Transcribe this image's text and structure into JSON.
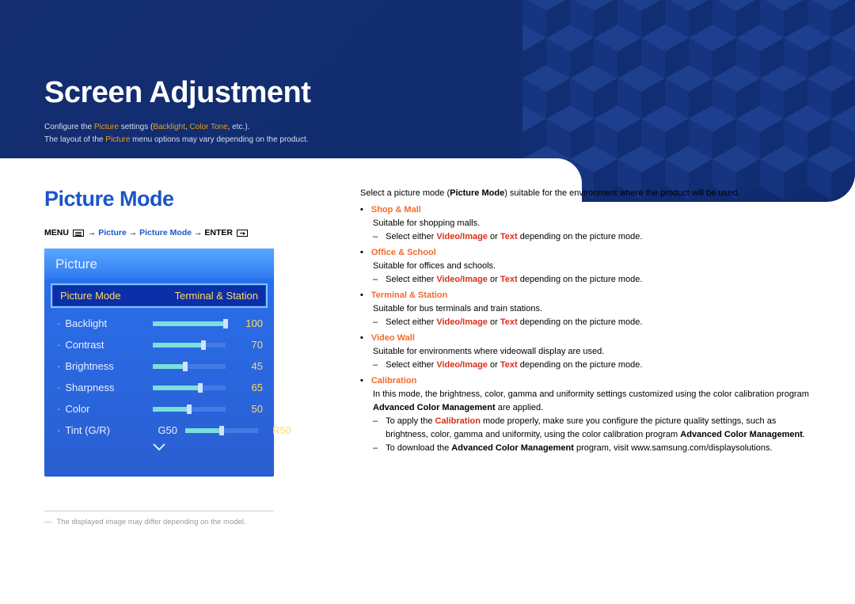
{
  "header": {
    "title": "Screen Adjustment",
    "intro_pre": "Configure the ",
    "intro_hl1": "Picture",
    "intro_mid": " settings (",
    "intro_hl2": "Backlight",
    "intro_sep": ", ",
    "intro_hl3": "Color Tone",
    "intro_post": ", etc.).",
    "intro2_pre": "The layout of the ",
    "intro2_hl": "Picture",
    "intro2_post": " menu options may vary depending on the product."
  },
  "section": {
    "title": "Picture Mode",
    "breadcrumb": {
      "menu": "MENU",
      "arrow": " → ",
      "b1": "Picture",
      "b2": "Picture Mode",
      "enter": "ENTER"
    }
  },
  "osd": {
    "panel_title": "Picture",
    "selected_label": "Picture Mode",
    "selected_value": "Terminal & Station",
    "rows": [
      {
        "label": "Backlight",
        "value": 100
      },
      {
        "label": "Contrast",
        "value": 70
      },
      {
        "label": "Brightness",
        "value": 45
      },
      {
        "label": "Sharpness",
        "value": 65
      },
      {
        "label": "Color",
        "value": 50
      }
    ],
    "tint": {
      "label": "Tint (G/R)",
      "left": "G50",
      "right": "R50",
      "value": 50
    }
  },
  "footnote": "The displayed image may differ depending on the model.",
  "content": {
    "intro_pre": "Select a picture mode (",
    "intro_bold": "Picture Mode",
    "intro_post": ") suitable for the environment where the product will be used.",
    "vt_pre": "Select either ",
    "vt_a": "Video/Image",
    "vt_mid": " or ",
    "vt_b": "Text",
    "vt_post": " depending on the picture mode.",
    "modes": [
      {
        "name": "Shop & Mall",
        "desc": "Suitable for shopping malls.",
        "has_vt": true
      },
      {
        "name": "Office & School",
        "desc": "Suitable for offices and schools.",
        "has_vt": true
      },
      {
        "name": "Terminal & Station",
        "desc": "Suitable for bus terminals and train stations.",
        "has_vt": true
      },
      {
        "name": "Video Wall",
        "desc": "Suitable for environments where videowall display are used.",
        "has_vt": true
      }
    ],
    "calibration": {
      "name": "Calibration",
      "desc_pre": "In this mode, the brightness, color, gamma and uniformity settings customized using the color calibration program ",
      "desc_bold": "Advanced Color Management",
      "desc_post": " are applied.",
      "sub1_pre": "To apply the ",
      "sub1_hl": "Calibration",
      "sub1_mid": " mode properly, make sure you configure the picture quality settings, such as brightness, color, gamma and uniformity, using the color calibration program ",
      "sub1_bold": "Advanced Color Management",
      "sub1_post": ".",
      "sub2_pre": "To download the ",
      "sub2_bold": "Advanced Color Management",
      "sub2_post": " program, visit www.samsung.com/displaysolutions."
    }
  }
}
